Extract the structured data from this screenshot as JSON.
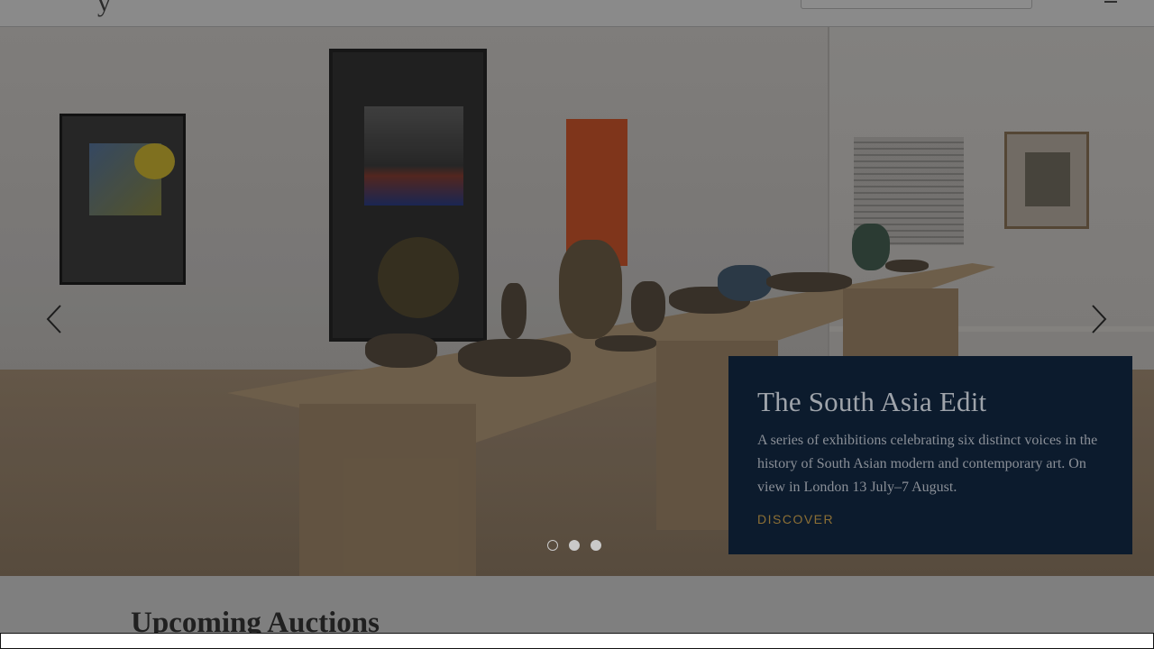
{
  "header": {
    "logo_text": "y",
    "search_placeholder": ""
  },
  "hero": {
    "caption": {
      "title": "The South Asia Edit",
      "body": "A series of exhibitions celebrating six distinct voices in the history of South Asian modern and contemporary art. On view in London 13 July–7 August.",
      "link_label": "DISCOVER"
    },
    "slides": {
      "count": 3,
      "active_index": 0
    }
  },
  "section": {
    "title": "Upcoming Auctions"
  },
  "colors": {
    "caption_background": "#0c1b2d",
    "link_accent": "#8c6f35",
    "overlay": "#7f7f7f"
  },
  "icons": {
    "prev": "chevron-left-icon",
    "next": "chevron-right-icon",
    "account": "user-icon"
  }
}
